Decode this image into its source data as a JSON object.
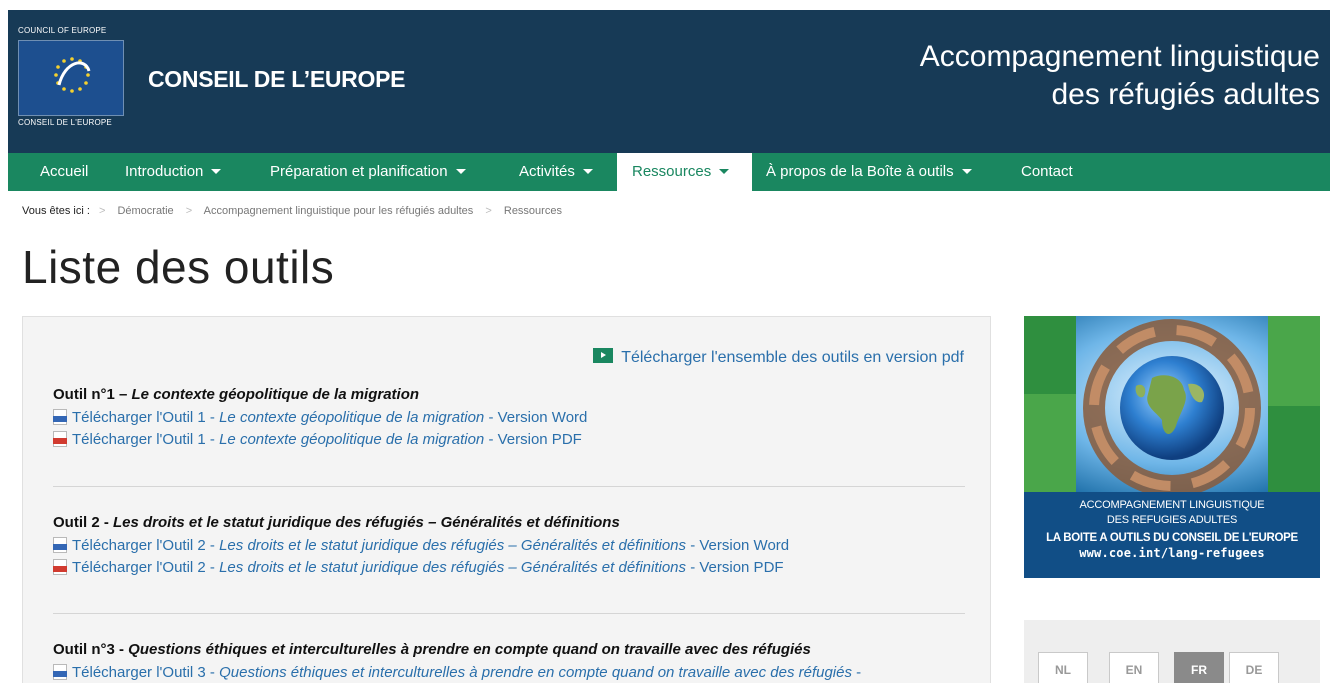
{
  "header": {
    "logo_top": "COUNCIL OF EUROPE",
    "logo_bottom": "CONSEIL DE L'EUROPE",
    "brand_name": "CONSEIL DE L’EUROPE",
    "site_title_line1": "Accompagnement linguistique",
    "site_title_line2": "des réfugiés adultes",
    "colors": {
      "header_bg": "#173a56",
      "nav_bg": "#1a8760",
      "link": "#2a6fab"
    }
  },
  "nav": {
    "items": [
      {
        "label": "Accueil",
        "dropdown": false,
        "active": false
      },
      {
        "label": "Introduction",
        "dropdown": true,
        "active": false
      },
      {
        "label": "Préparation et planification",
        "dropdown": true,
        "active": false
      },
      {
        "label": "Activités",
        "dropdown": true,
        "active": false
      },
      {
        "label": "Ressources",
        "dropdown": true,
        "active": true
      },
      {
        "label": "À propos de la Boîte à outils",
        "dropdown": true,
        "active": false
      },
      {
        "label": "Contact",
        "dropdown": false,
        "active": false
      }
    ]
  },
  "breadcrumb": {
    "lead": "Vous êtes ici :",
    "items": [
      "Démocratie",
      "Accompagnement linguistique pour les réfugiés adultes",
      "Ressources"
    ]
  },
  "page_title": "Liste des outils",
  "download_all": {
    "label": "Télécharger l'ensemble des outils en version pdf",
    "icon": "folder-download-icon"
  },
  "tools": [
    {
      "prefix": "Outil n°1 – ",
      "title": "Le contexte géopolitique de la migration",
      "downloads": [
        {
          "type": "doc",
          "pre": "Télécharger l'Outil 1 - ",
          "title": "Le contexte géopolitique de la migration",
          "post": "  - Version Word"
        },
        {
          "type": "pdf",
          "pre": "Télécharger l'Outil 1 - ",
          "title": "Le contexte géopolitique de la migration",
          "post": " - Version PDF"
        }
      ]
    },
    {
      "prefix": "Outil 2 - ",
      "title": "Les droits et le statut juridique des réfugiés – Généralités et définitions",
      "downloads": [
        {
          "type": "doc",
          "pre": "Télécharger l'Outil 2 - ",
          "title": "Les droits et le statut juridique des réfugiés – Généralités et définitions",
          "post": " - Version Word"
        },
        {
          "type": "pdf",
          "pre": "Télécharger l'Outil 2 - ",
          "title": "Les droits et le statut juridique des réfugiés – Généralités et définitions",
          "post": " - Version PDF"
        }
      ]
    },
    {
      "prefix": "Outil n°3 - ",
      "title": "Questions éthiques et interculturelles à prendre en compte quand on travaille avec des réfugiés",
      "downloads": [
        {
          "type": "doc",
          "pre": "Télécharger l'Outil 3 - ",
          "title": "Questions éthiques et interculturelles à prendre en compte quand on travaille avec des réfugiés",
          "post": " -"
        }
      ]
    }
  ],
  "promo": {
    "line1": "ACCOMPAGNEMENT LINGUISTIQUE",
    "line2": "DES REFUGIES ADULTES",
    "line3": "LA BOITE A OUTILS DU CONSEIL DE L'EUROPE",
    "line4": "www.coe.int/lang-refugees"
  },
  "languages": [
    {
      "code": "NL",
      "active": false
    },
    {
      "code": "EN",
      "active": false
    },
    {
      "code": "FR",
      "active": true
    },
    {
      "code": "DE",
      "active": false
    }
  ]
}
